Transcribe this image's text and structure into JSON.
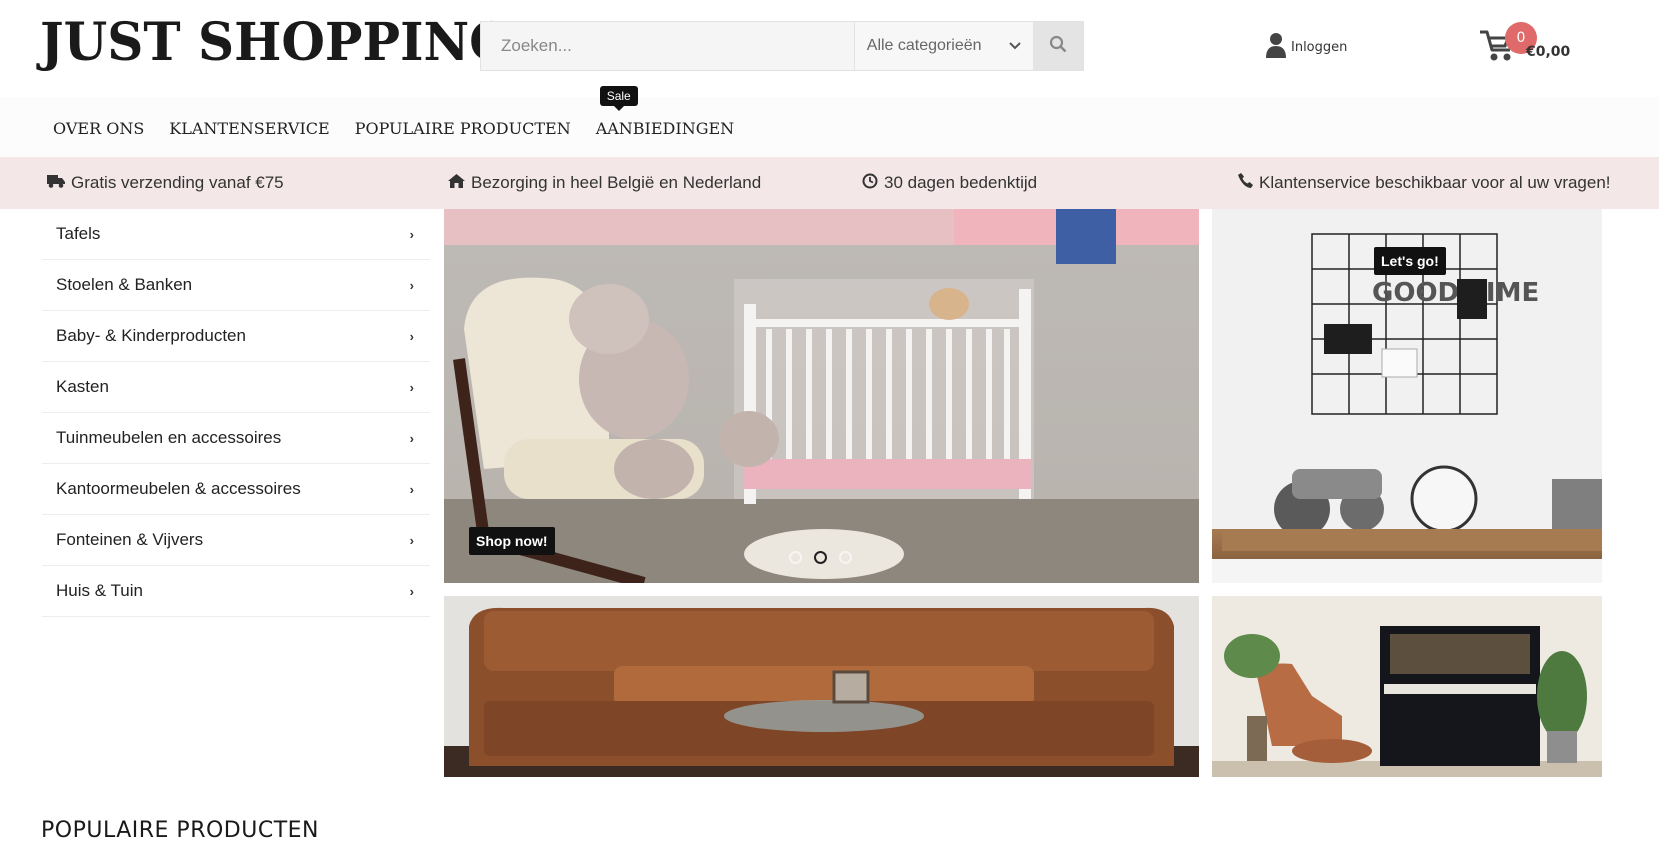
{
  "header": {
    "logo_text": "JUST SHOPPING",
    "search": {
      "placeholder": "Zoeken...",
      "category": "Alle categorieën"
    },
    "login_label": "Inloggen",
    "cart": {
      "count": "0",
      "total": "€0,00"
    }
  },
  "nav": {
    "items": [
      {
        "label": "OVER ONS"
      },
      {
        "label": "KLANTENSERVICE"
      },
      {
        "label": "POPULAIRE PRODUCTEN"
      },
      {
        "label": "AANBIEDINGEN",
        "badge": "Sale"
      }
    ]
  },
  "usp": [
    {
      "icon": "truck-icon",
      "text": "Gratis verzending vanaf €75"
    },
    {
      "icon": "home-icon",
      "text": "Bezorging in heel België en Nederland"
    },
    {
      "icon": "clock-icon",
      "text": "30 dagen bedenktijd"
    },
    {
      "icon": "phone-icon",
      "text": "Klantenservice beschikbaar voor al uw vragen!"
    }
  ],
  "categories": [
    {
      "label": "Tafels"
    },
    {
      "label": "Stoelen & Banken"
    },
    {
      "label": "Baby- & Kinderproducten"
    },
    {
      "label": "Kasten"
    },
    {
      "label": "Tuinmeubelen en accessoires"
    },
    {
      "label": "Kantoormeubelen & accessoires"
    },
    {
      "label": "Fonteinen & Vijvers"
    },
    {
      "label": "Huis & Tuin"
    }
  ],
  "banners": {
    "main_cta": "Shop now!",
    "side_cta": "Let's go!",
    "side_board_text": "GOOD TIME"
  },
  "section_title": "POPULAIRE PRODUCTEN",
  "colors": {
    "usp_bg": "#f3e7e8",
    "cart_badge": "#e06a6a",
    "badge_bg": "#111111"
  }
}
